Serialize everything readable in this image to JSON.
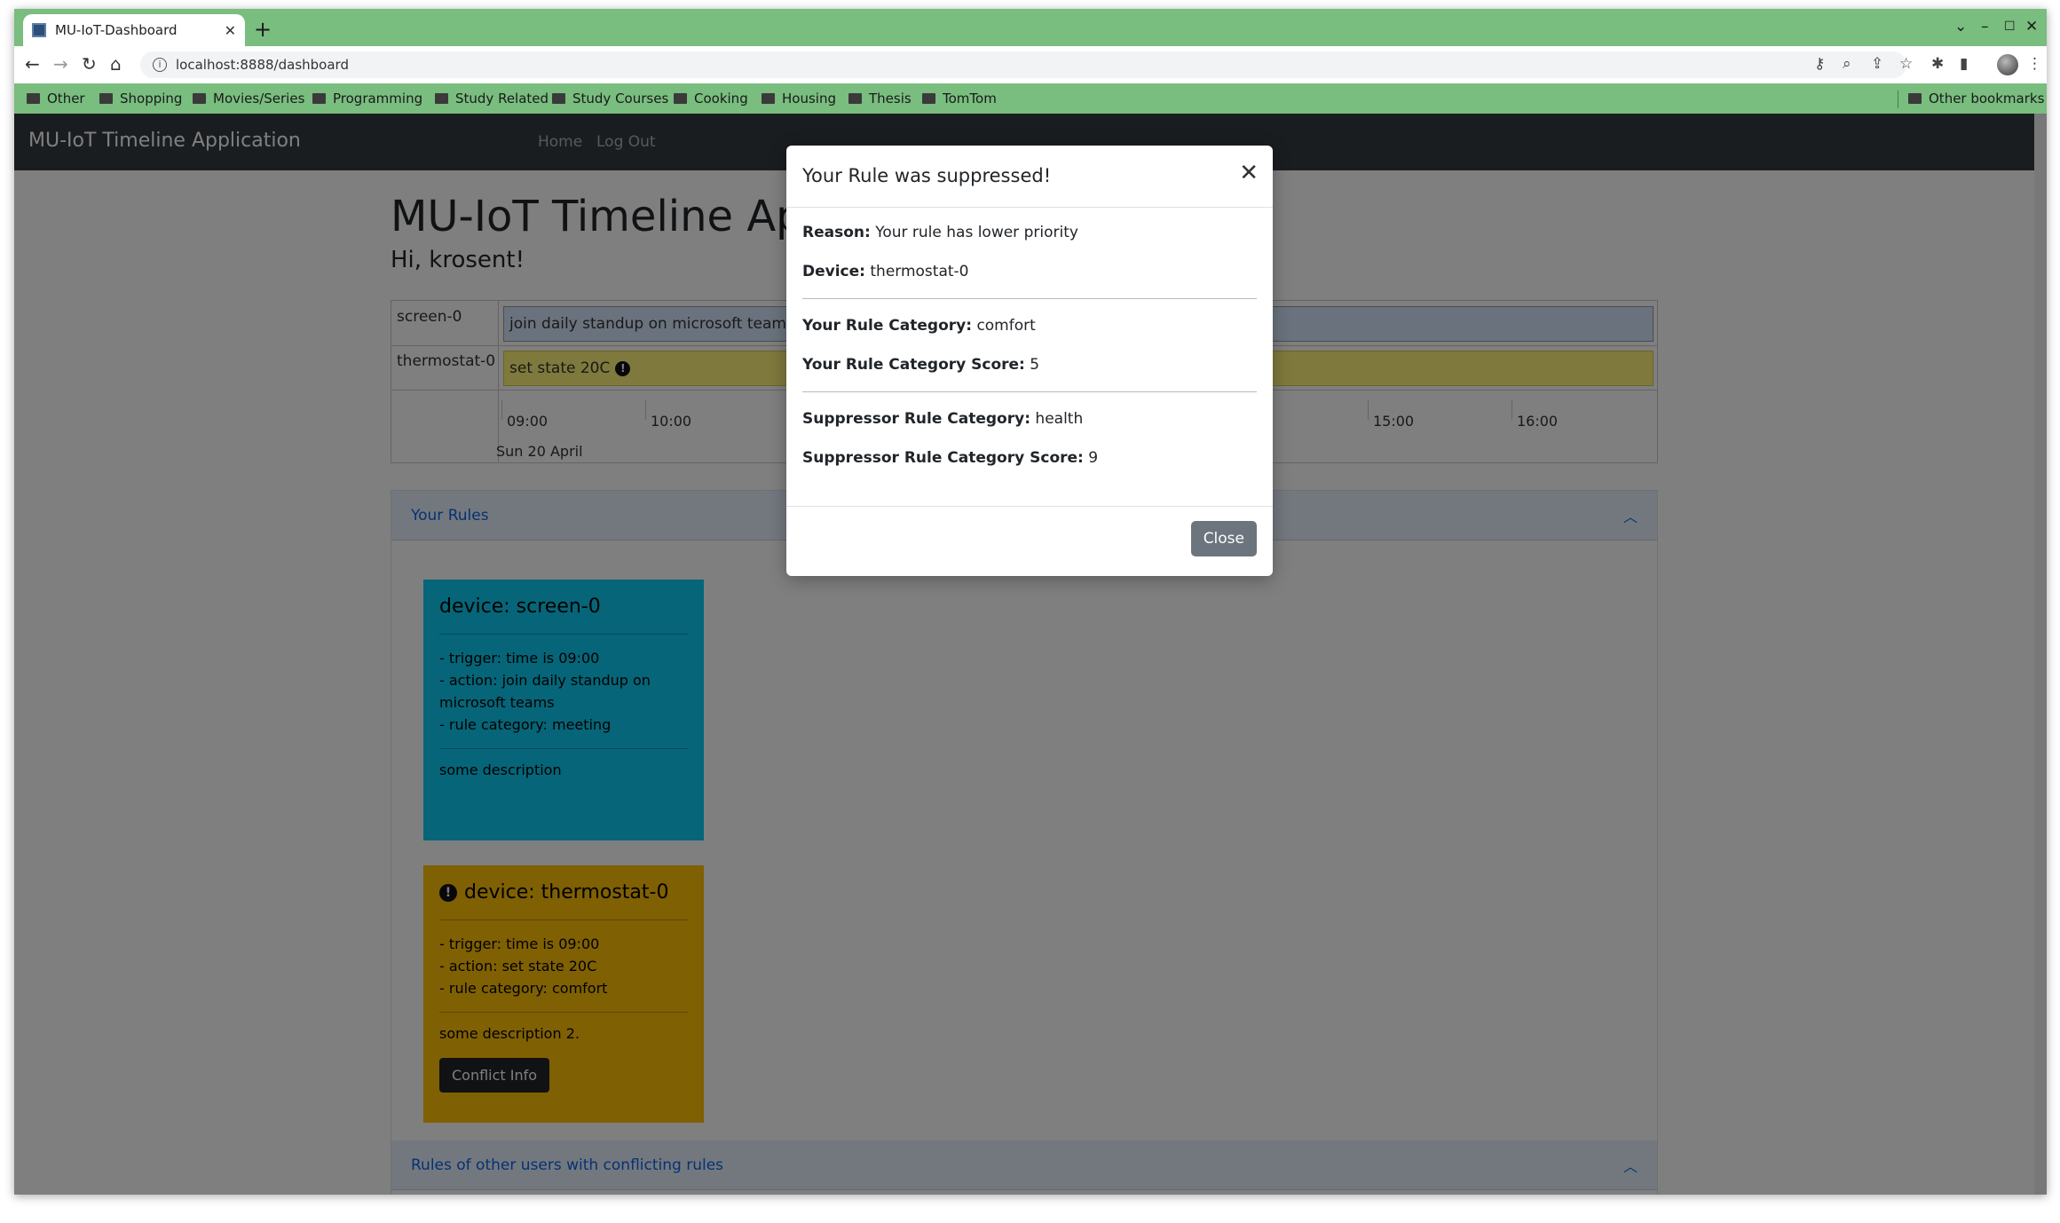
{
  "browser": {
    "tab_title": "MU-IoT-Dashboard",
    "url": "localhost:8888/dashboard",
    "bookmarks": [
      "Other",
      "Shopping",
      "Movies/Series",
      "Programming",
      "Study Related",
      "Study Courses",
      "Cooking",
      "Housing",
      "Thesis",
      "TomTom"
    ],
    "other_bookmarks": "Other bookmarks",
    "accent_color": "#79bd7f"
  },
  "navbar": {
    "brand": "MU-IoT Timeline Application",
    "home": "Home",
    "logout": "Log Out"
  },
  "page": {
    "heading": "MU-IoT Timeline Application",
    "greeting": "Hi, krosent!"
  },
  "timeline": {
    "rows": [
      {
        "device": "screen-0",
        "event": "join daily standup on microsoft teams"
      },
      {
        "device": "thermostat-0",
        "event": "set state 20C"
      }
    ],
    "ticks": [
      "09:00",
      "10:00",
      "15:00",
      "16:00"
    ],
    "date": "Sun 20 April",
    "colors": {
      "screen": "#d5e6fb",
      "thermostat": "#fff27a"
    }
  },
  "accordion": {
    "your_rules_title": "Your Rules",
    "others_title": "Rules of other users with conflicting rules"
  },
  "rules": [
    {
      "title": "device: screen-0",
      "trigger": "- trigger: time is 09:00",
      "action": "- action: join daily standup on microsoft teams",
      "category": "- rule category: meeting",
      "description": "some description"
    },
    {
      "title": "device: thermostat-0",
      "trigger": "- trigger: time is 09:00",
      "action": "- action: set state 20C",
      "category": "- rule category: comfort",
      "description": "some description 2.",
      "button": "Conflict Info"
    }
  ],
  "modal": {
    "title": "Your Rule was suppressed!",
    "reason_label": "Reason:",
    "reason_value": "Your rule has lower priority",
    "device_label": "Device:",
    "device_value": "thermostat-0",
    "category_label": "Your Rule Category:",
    "category_value": "comfort",
    "score_label": "Your Rule Category Score:",
    "score_value": "5",
    "supp_category_label": "Suppressor Rule Category:",
    "supp_category_value": "health",
    "supp_score_label": "Suppressor Rule Category Score:",
    "supp_score_value": "9",
    "close_button": "Close"
  }
}
